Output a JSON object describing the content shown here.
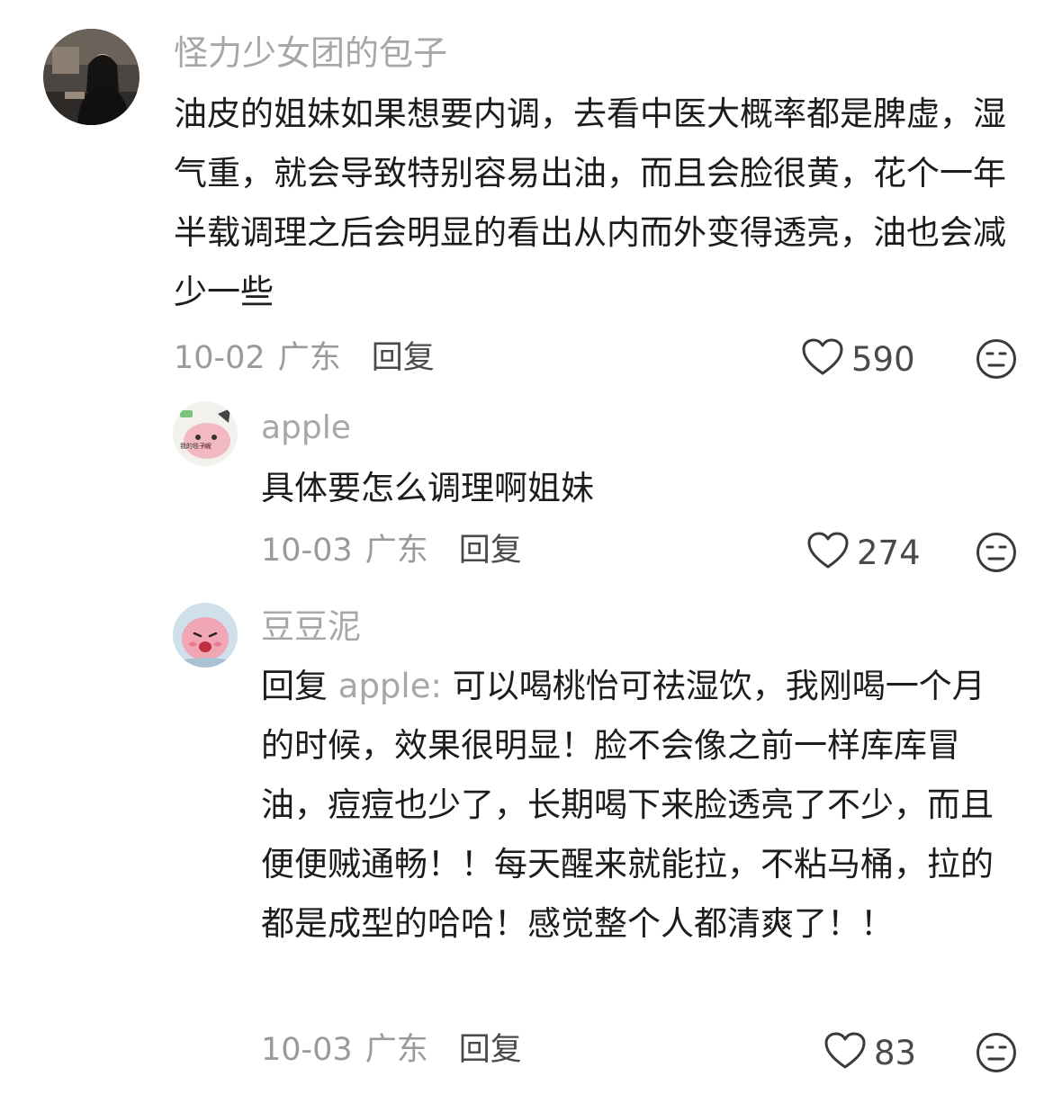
{
  "comments": [
    {
      "username": "怪力少女团的包子",
      "text": "油皮的姐妹如果想要内调，去看中医大概率都是脾虚，湿气重，就会导致特别容易出油，而且会脸很黄，花个一年半载调理之后会明显的看出从内而外变得透亮，油也会减少一些",
      "date": "10-02",
      "location": "广东",
      "reply_label": "回复",
      "likes": "590"
    },
    {
      "username": "apple",
      "text": "具体要怎么调理啊姐妹",
      "date": "10-03",
      "location": "广东",
      "reply_label": "回复",
      "likes": "274",
      "avatar_text": "我的毯子呢"
    },
    {
      "username": "豆豆泥",
      "reply_prefix": "回复",
      "reply_to": "apple",
      "reply_sep": ": ",
      "text": "可以喝桃怡可祛湿饮，我刚喝一个月的时候，效果很明显！脸不会像之前一样库库冒油，痘痘也少了，长期喝下来脸透亮了不少，而且便便贼通畅！！每天醒来就能拉，不粘马桶，拉的都是成型的哈哈！感觉整个人都清爽了！！",
      "date": "10-03",
      "location": "广东",
      "reply_label": "回复",
      "likes": "83"
    }
  ],
  "icons": {
    "like": "heart-outline-icon",
    "emoji": "neutral-face-icon"
  }
}
